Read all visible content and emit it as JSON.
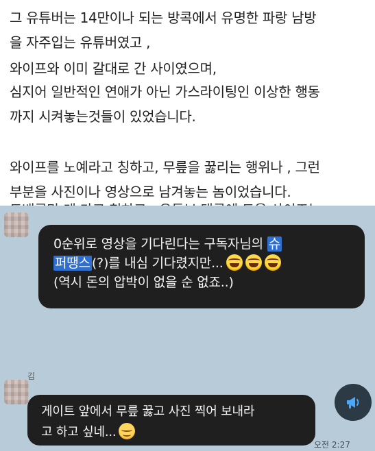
{
  "article": {
    "lines": [
      "그 유튜버는 14만이나 되는 방콕에서 유명한 파랑 남방",
      "을 자주입는 유튜버였고 ,",
      "와이프와 이미 갈대로 간 사이였으며,",
      "심지어 일반적인 연애가 아닌 가스라이팅인 이상한 행동",
      "까지 시켜놓는것들이 있었습니다.",
      "와이프를 노예라고 칭하고, 무릎을 꿇리는 행위나 , 그런",
      "부분을 사진이나 영상으로 남겨놓는 놈이었습니다.",
      "도배콩만 게 가고 칭하고 - 유튜브 댓글에 도움 사이즈는"
    ]
  },
  "chat1": {
    "line1_prefix": "0순위로 영상을 기다린다는 구독자님의 ",
    "line1_highlight": "슈",
    "line2_highlight": "퍼땡스",
    "line2_rest": "(?)를 내심 기다렸지만...",
    "line3": "(역시 돈의 압박이 없을 순 없죠..)",
    "emoji": "laughing-tears"
  },
  "chat2": {
    "sender_name": "김",
    "line1": "게이트 앞에서 무릎 꿇고 사진 찍어 보내라",
    "line2": "고 하고 싶네...",
    "emoji": "relieved-face",
    "time": "오전 2:27",
    "fab_icon": "megaphone-icon"
  },
  "colors": {
    "chat_background": "#b7cbd9",
    "bubble": "#1f1f1f",
    "highlight": "#2f6fcf",
    "fab": "#2b3a44"
  }
}
